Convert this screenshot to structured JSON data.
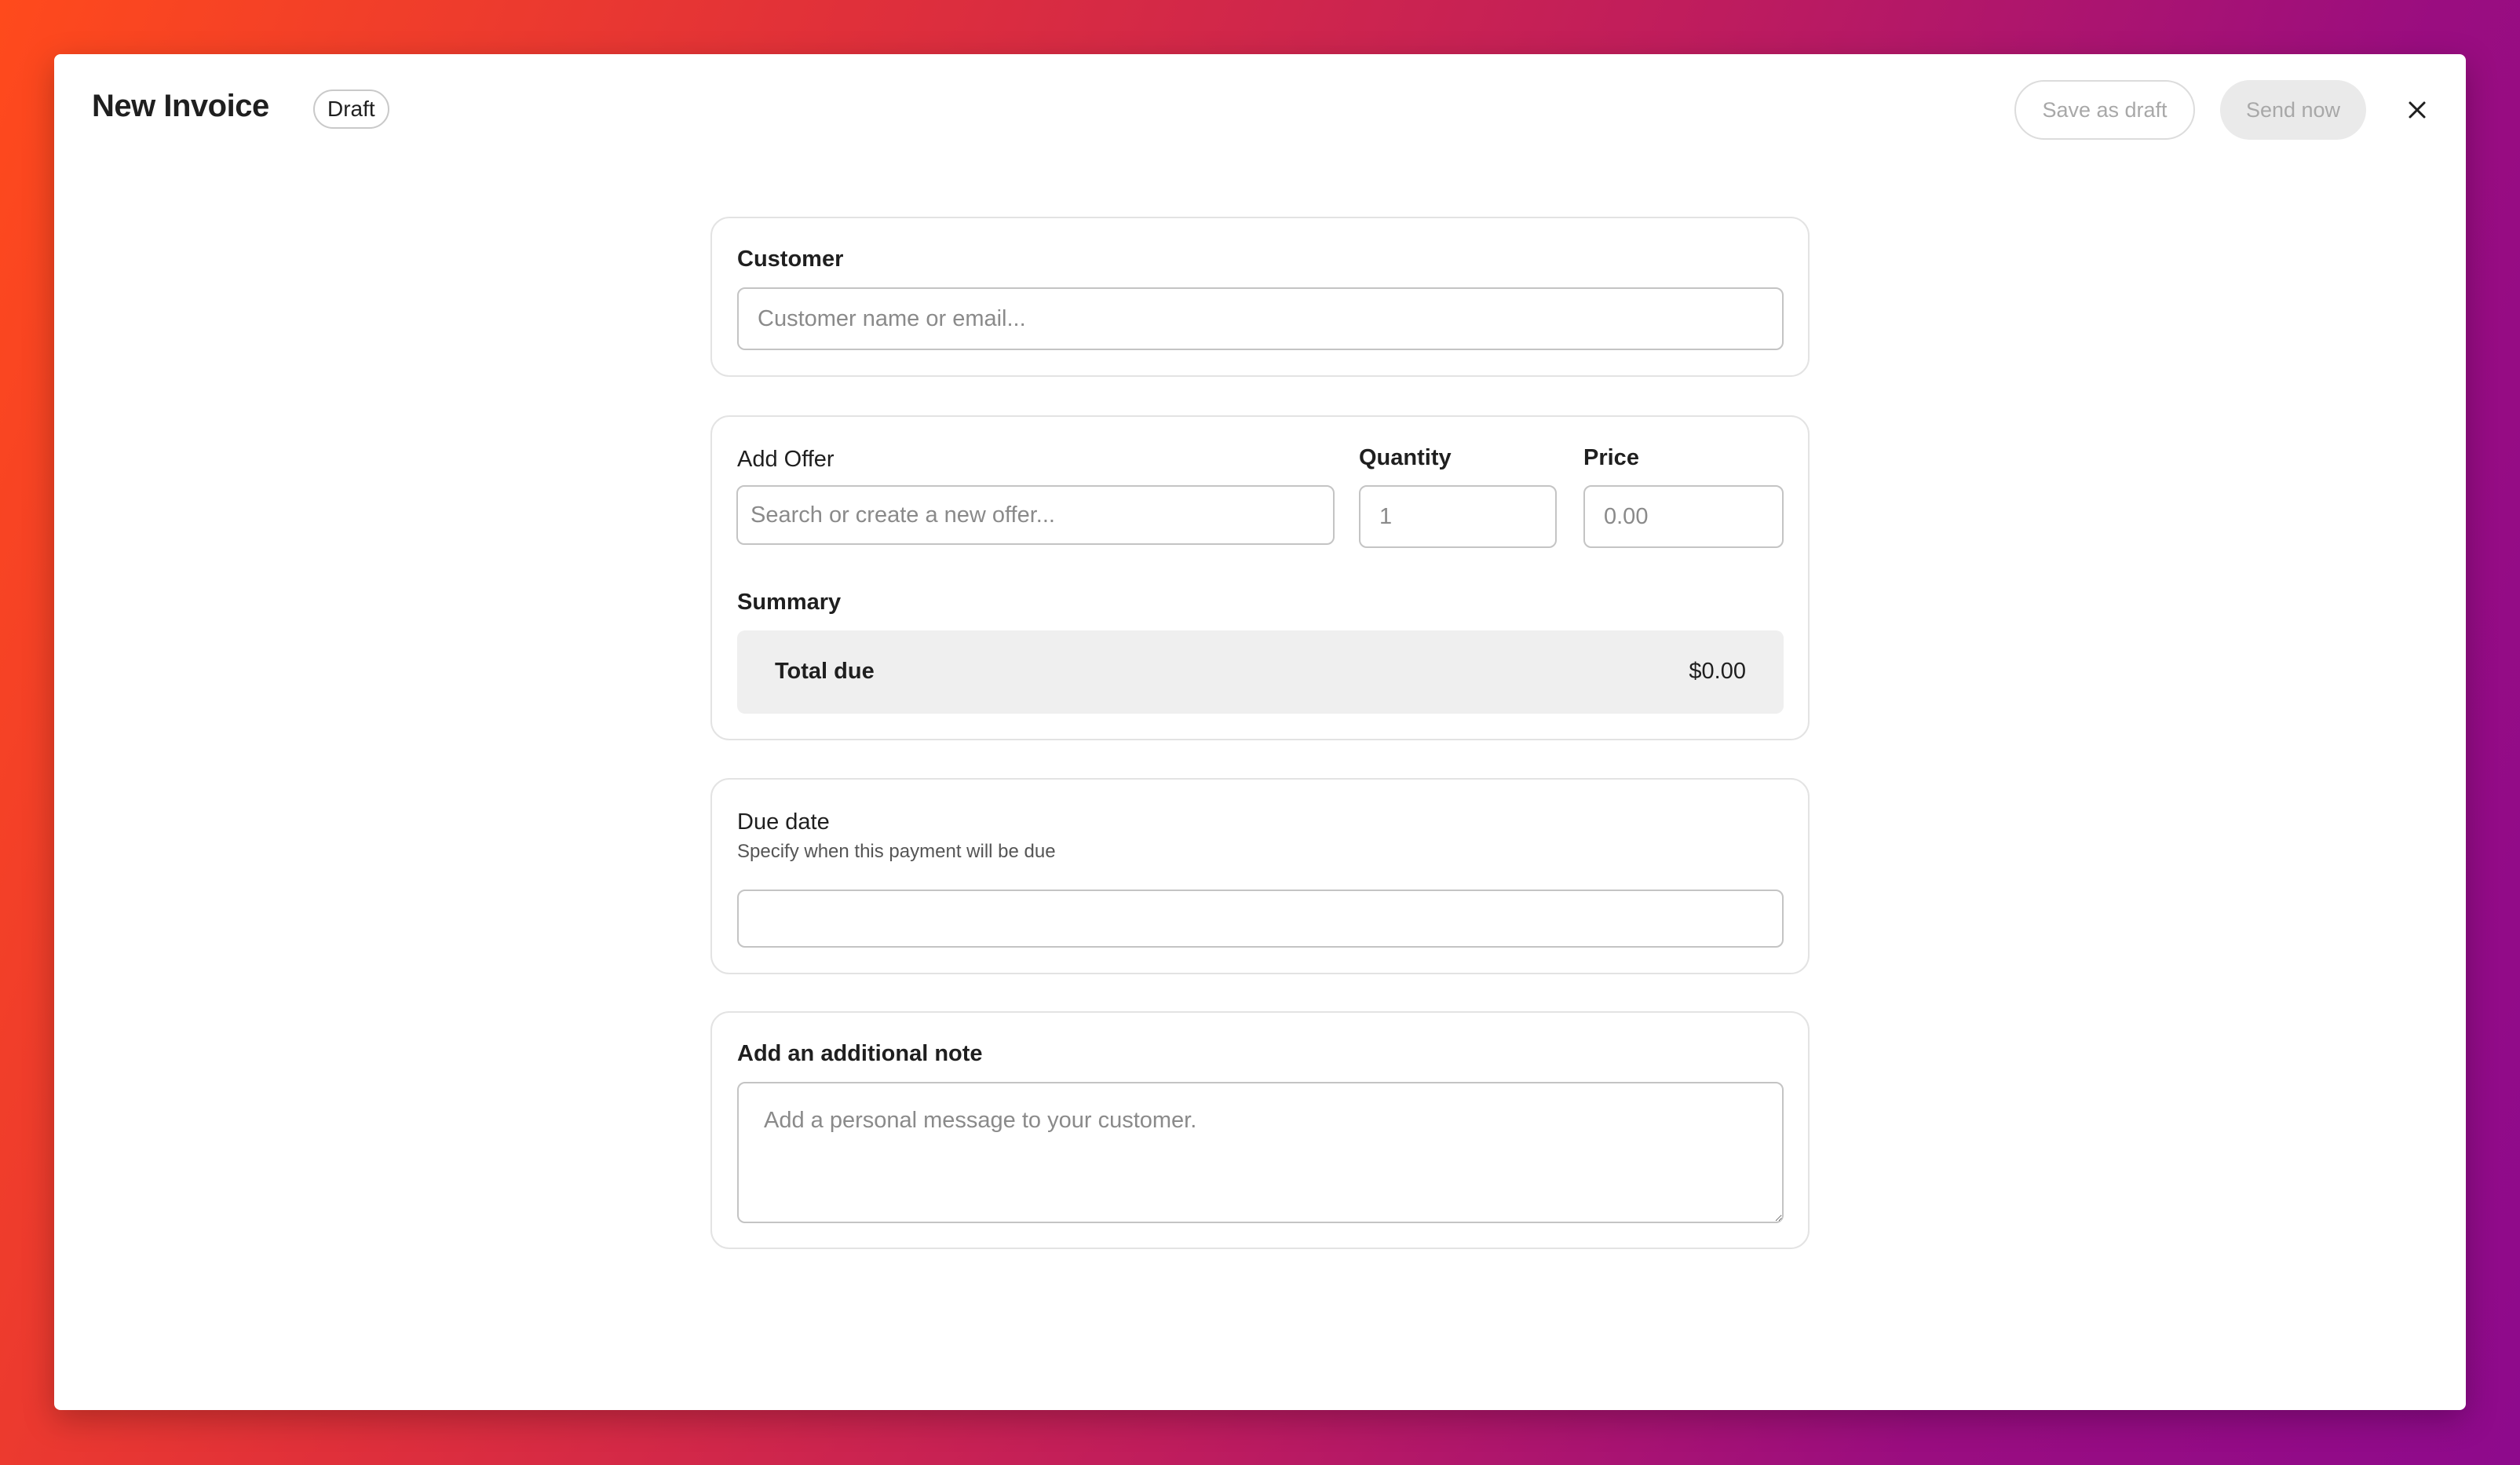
{
  "header": {
    "title": "New Invoice",
    "status_badge": "Draft",
    "save_draft_label": "Save as draft",
    "send_now_label": "Send now",
    "close_icon": "close-icon"
  },
  "customer": {
    "label": "Customer",
    "placeholder": "Customer name or email..."
  },
  "offer": {
    "label": "Add Offer",
    "placeholder": "Search or create a new offer...",
    "quantity_label": "Quantity",
    "quantity_placeholder": "1",
    "price_label": "Price",
    "price_placeholder": "0.00",
    "summary_label": "Summary",
    "total_label": "Total due",
    "total_value": "$0.00"
  },
  "due_date": {
    "label": "Due date",
    "description": "Specify when this payment will be due",
    "value": ""
  },
  "note": {
    "label": "Add an additional note",
    "placeholder": "Add a personal message to your customer."
  },
  "colors": {
    "background_gradient_start": "#ff4a1c",
    "background_gradient_end": "#8e0a8c",
    "summary_bg": "#efefef",
    "disabled_text": "#a8a8a8"
  }
}
